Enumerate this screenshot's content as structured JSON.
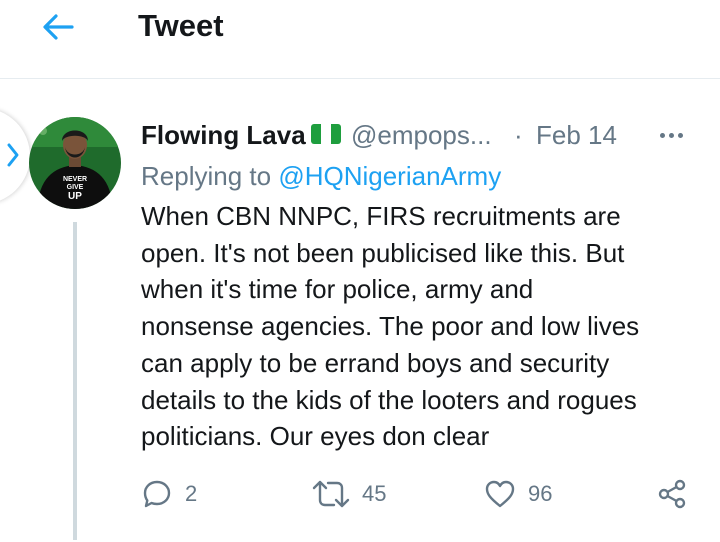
{
  "header": {
    "title": "Tweet",
    "back_icon": "arrow-left-icon"
  },
  "colors": {
    "accent": "#1da1f2",
    "muted": "#657786",
    "text": "#14171a",
    "divider": "#e6ecf0"
  },
  "tweet": {
    "author_name": "Flowing Lava",
    "author_flag": "nigeria-flag-icon",
    "handle": "@empops...",
    "separator": "·",
    "date": "Feb 14",
    "replying_prefix": "Replying to ",
    "replying_to": "@HQNigerianArmy",
    "text_lines": [
      "When CBN NNPC, FIRS recruitments are",
      "open. It's not been publicised like this. But",
      "when it's time for police, army and",
      "nonsense agencies. The poor and low lives",
      "can apply to be errand boys and security",
      "details to the kids of the looters and rogues",
      "politicians. Our eyes don clear"
    ]
  },
  "actions": {
    "reply_count": "2",
    "retweet_count": "45",
    "like_count": "96"
  }
}
